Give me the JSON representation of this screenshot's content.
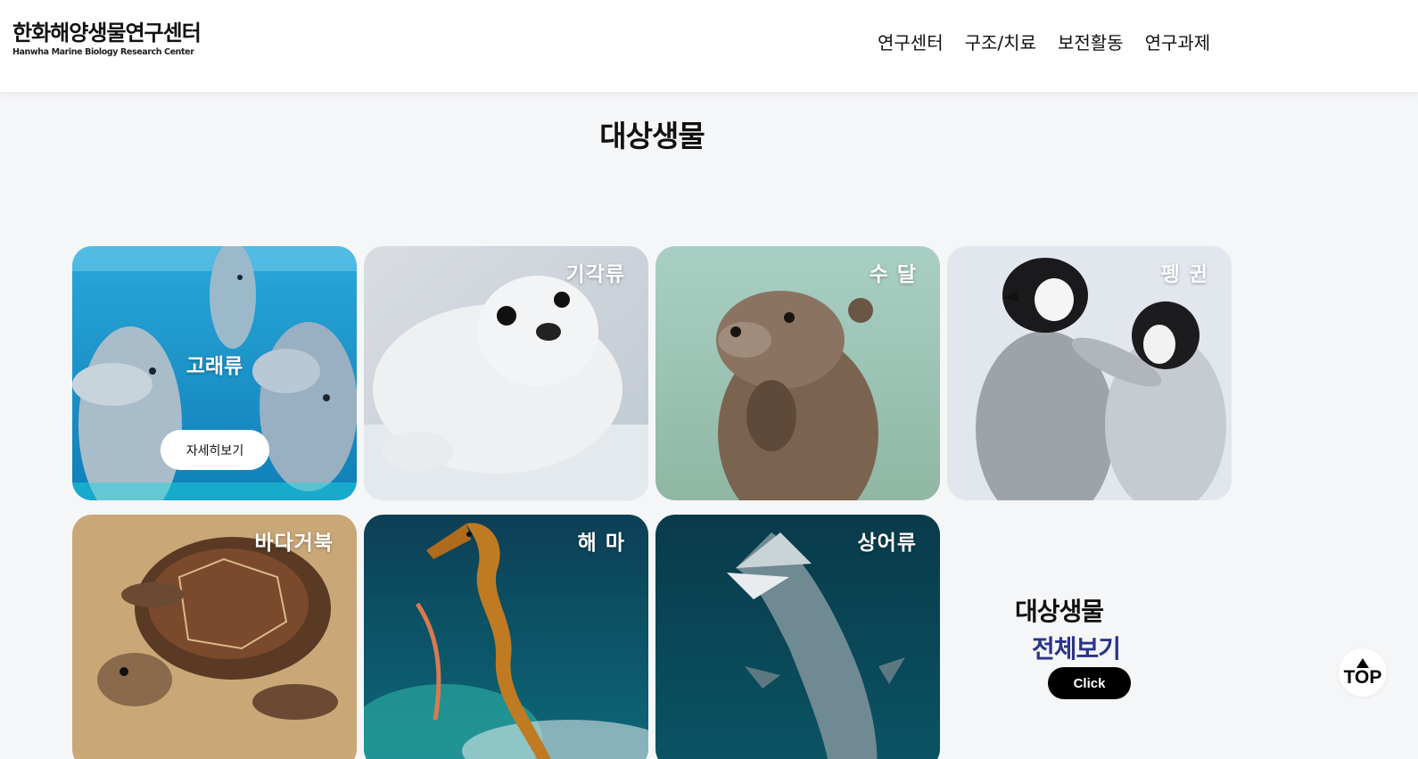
{
  "header": {
    "logo_kr": "한화해양생물연구센터",
    "logo_en": "Hanwha Marine Biology Research Center",
    "nav": [
      "연구센터",
      "구조/치료",
      "보전활동",
      "연구과제"
    ]
  },
  "section": {
    "title": "대상생물"
  },
  "cards": [
    {
      "label": "고래류",
      "button": "자세히보기",
      "image": "dolphins"
    },
    {
      "label": "기각류",
      "image": "seal-pup"
    },
    {
      "label": "수 달",
      "image": "otter"
    },
    {
      "label": "펭 귄",
      "image": "penguin-chicks"
    },
    {
      "label": "바다거북",
      "image": "sea-turtle"
    },
    {
      "label": "해 마",
      "image": "seahorse"
    },
    {
      "label": "상어류",
      "image": "shark"
    }
  ],
  "view_all": {
    "title": "대상생물",
    "subtitle": "전체보기",
    "button": "Click"
  },
  "top_button": {
    "label": "TOP"
  },
  "colors": {
    "accent": "#2b3488",
    "header_bg": "#ffffff",
    "page_bg": "#f5f6f8"
  }
}
